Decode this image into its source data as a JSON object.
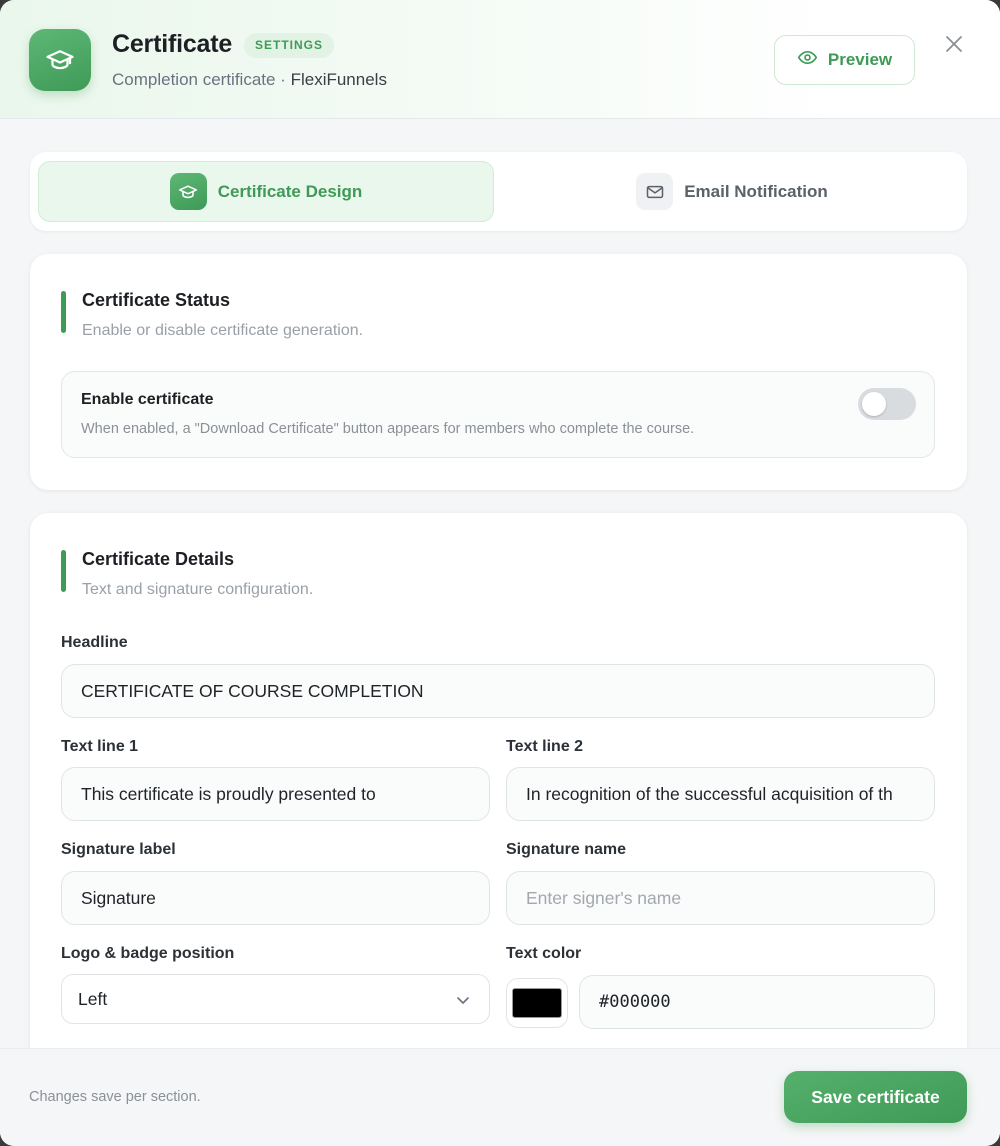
{
  "header": {
    "title": "Certificate",
    "badge": "SETTINGS",
    "subtitle_prefix": "Completion certificate · ",
    "subtitle_brand": "FlexiFunnels",
    "preview_label": "Preview",
    "icon": "graduation-cap-icon"
  },
  "tabs": [
    {
      "label": "Certificate Design",
      "icon": "graduation-cap-icon",
      "active": true
    },
    {
      "label": "Email Notification",
      "icon": "mail-icon",
      "active": false
    }
  ],
  "status_section": {
    "title": "Certificate Status",
    "subtitle": "Enable or disable certificate generation.",
    "toggle_title": "Enable certificate",
    "toggle_desc": "When enabled, a \"Download Certificate\" button appears for members who complete the course.",
    "enabled": false
  },
  "details_section": {
    "title": "Certificate Details",
    "subtitle": "Text and signature configuration.",
    "headline": {
      "label": "Headline",
      "value": "CERTIFICATE OF COURSE COMPLETION"
    },
    "text_line_1": {
      "label": "Text line 1",
      "value": "This certificate is proudly presented to"
    },
    "text_line_2": {
      "label": "Text line 2",
      "value": "In recognition of the successful acquisition of th"
    },
    "signature_label": {
      "label": "Signature label",
      "value": "Signature"
    },
    "signature_name": {
      "label": "Signature name",
      "value": "",
      "placeholder": "Enter signer's name"
    },
    "logo_position": {
      "label": "Logo & badge position",
      "value": "Left"
    },
    "text_color": {
      "label": "Text color",
      "value": "#000000",
      "swatch": "#000000"
    }
  },
  "footer": {
    "note": "Changes save per section.",
    "save_label": "Save certificate"
  },
  "colors": {
    "accent": "#3f9a57",
    "accent_light": "#e9f7ec"
  }
}
